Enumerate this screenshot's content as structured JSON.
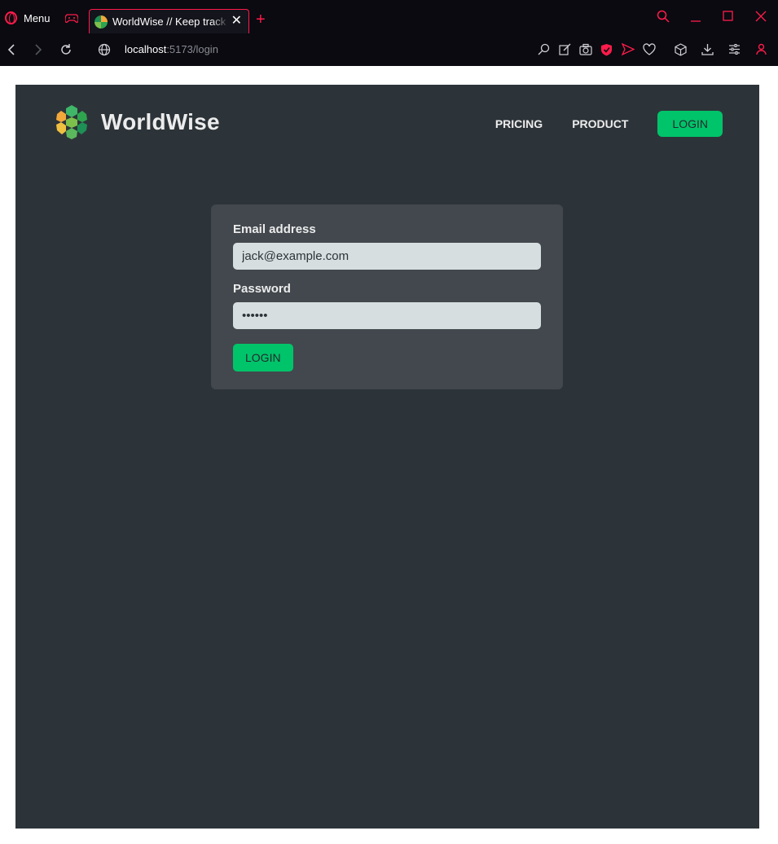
{
  "browser": {
    "menu_label": "Menu",
    "tab_title": "WorldWise // Keep track of your adventures",
    "url_host": "localhost",
    "url_path": ":5173/login",
    "accent_color": "#ff1b4b"
  },
  "header": {
    "logo_text": "WorldWise",
    "nav": {
      "pricing": "PRICING",
      "product": "PRODUCT",
      "login": "LOGIN"
    }
  },
  "login_form": {
    "email_label": "Email address",
    "email_value": "jack@example.com",
    "password_label": "Password",
    "password_value": "qwerty",
    "submit_label": "LOGIN"
  },
  "colors": {
    "page_bg": "#2d3439",
    "form_bg": "#42484d",
    "brand_green": "#00c46a",
    "input_bg": "#d6dee0"
  }
}
